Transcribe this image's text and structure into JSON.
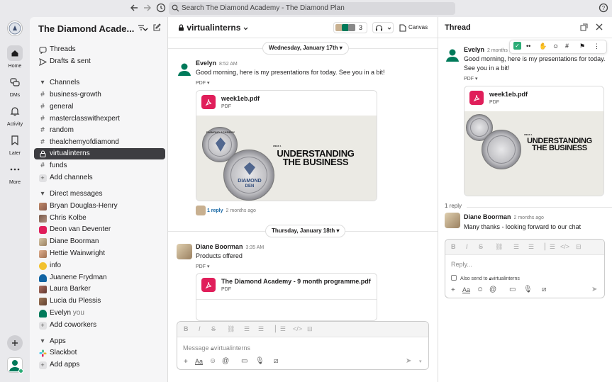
{
  "search": {
    "placeholder": "Search The Diamond Academy - The Diamond Plan"
  },
  "rail": {
    "home": "Home",
    "dms": "DMs",
    "activity": "Activity",
    "later": "Later",
    "more": "More"
  },
  "sidebar": {
    "workspace": "The Diamond Acade...",
    "threads": "Threads",
    "drafts": "Drafts & sent",
    "channels_header": "Channels",
    "channels": [
      "business-growth",
      "general",
      "masterclasswithexpert",
      "random",
      "thealchemyofdiamond",
      "virtualinterns",
      "funds"
    ],
    "add_channels": "Add channels",
    "dm_header": "Direct messages",
    "dms": [
      "Bryan Douglas-Henry",
      "Chris Kolbe",
      "Deon van Deventer",
      "Diane Boorman",
      "Hettie Wainwright",
      "info",
      "Juanene Frydman",
      "Laura Barker",
      "Lucia du Plessis",
      "Evelyn"
    ],
    "you": "you",
    "add_coworkers": "Add coworkers",
    "apps_header": "Apps",
    "apps": [
      "Slackbot"
    ],
    "add_apps": "Add apps"
  },
  "channel": {
    "name": "virtualinterns",
    "member_count": "3",
    "canvas": "Canvas",
    "date1": "Wednesday, January 17th",
    "date2": "Thursday, January 18th",
    "msg1": {
      "author": "Evelyn",
      "time": "8:52 AM",
      "text": "Good morning, here is my presentations for today. See you in a bit!",
      "pdf": "PDF",
      "file": "week1eb.pdf",
      "file_type": "PDF",
      "replies": "1 reply",
      "reply_time": "2 months ago"
    },
    "msg2": {
      "author": "Diane Boorman",
      "time": "3:35 AM",
      "text": "Products offered",
      "pdf": "PDF",
      "file": "The Diamond Academy - 9 month programme.pdf",
      "file_type": "PDF"
    },
    "composer_placeholder": "Message",
    "composer_channel": "virtualinterns"
  },
  "slide": {
    "week": "WEEK 1",
    "line1": "UNDERSTANDING",
    "line2": "THE BUSINESS",
    "seal1": "DIAMOND ACADEMY",
    "seal2": "DIAMOND",
    "seal2b": "DEN"
  },
  "thread": {
    "title": "Thread",
    "parent": {
      "author": "Evelyn",
      "time": "2 months a",
      "text": "Good morning, here is my presentations for today. See you in a bit!",
      "pdf": "PDF",
      "file": "week1eb.pdf",
      "file_type": "PDF"
    },
    "reply_count": "1 reply",
    "reply": {
      "author": "Diane Boorman",
      "time": "2 months ago",
      "text": "Many thanks - looking forward to our chat"
    },
    "reply_placeholder": "Reply...",
    "also_send": "Also send to",
    "also_channel": "virtualinterns"
  },
  "colors": {
    "accent": "#007a5a",
    "pdf": "#e01e5a",
    "link": "#1264a3",
    "active": "#3d3d41"
  }
}
